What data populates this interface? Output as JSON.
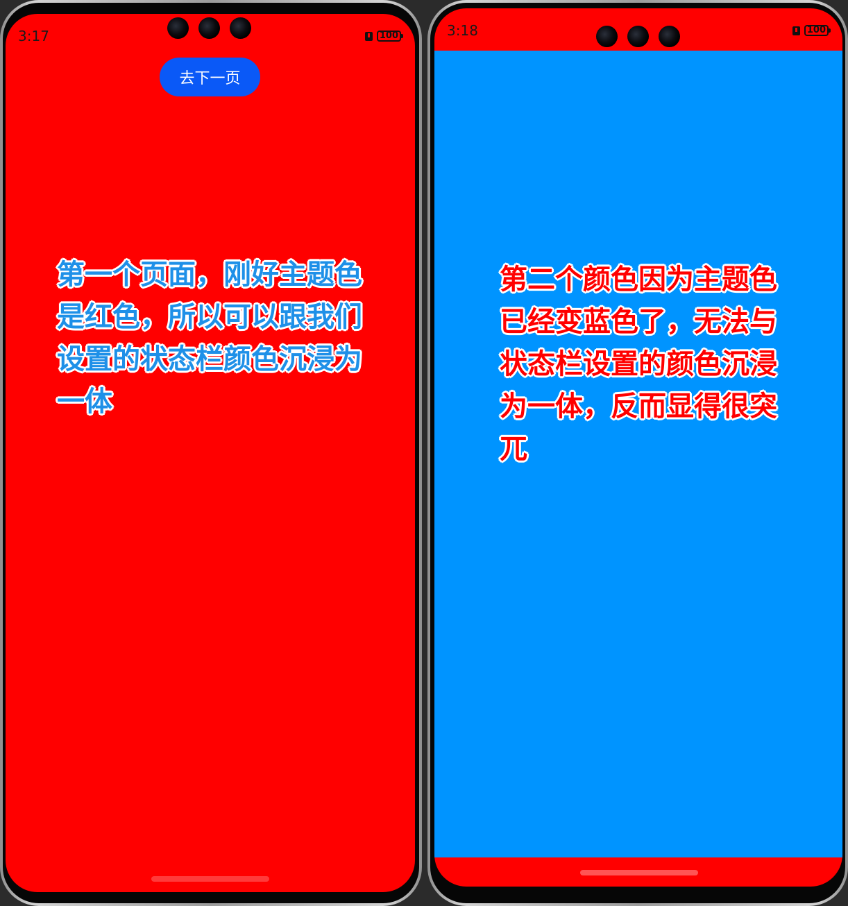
{
  "phone_left": {
    "status_time": "3:17",
    "battery_label": "100",
    "button_label": "去下一页",
    "caption": "第一个页面，刚好主题色是红色，所以可以跟我们设置的状态栏颜色沉浸为一体",
    "background_color": "#ff0000",
    "caption_color": "#1e90e8"
  },
  "phone_right": {
    "status_time": "3:18",
    "battery_label": "100",
    "caption": "第二个颜色因为主题色已经变蓝色了，无法与状态栏设置的颜色沉浸为一体，反而显得很突兀",
    "statusbar_color": "#ff0000",
    "content_color": "#0094ff",
    "caption_color": "#ff0000"
  }
}
